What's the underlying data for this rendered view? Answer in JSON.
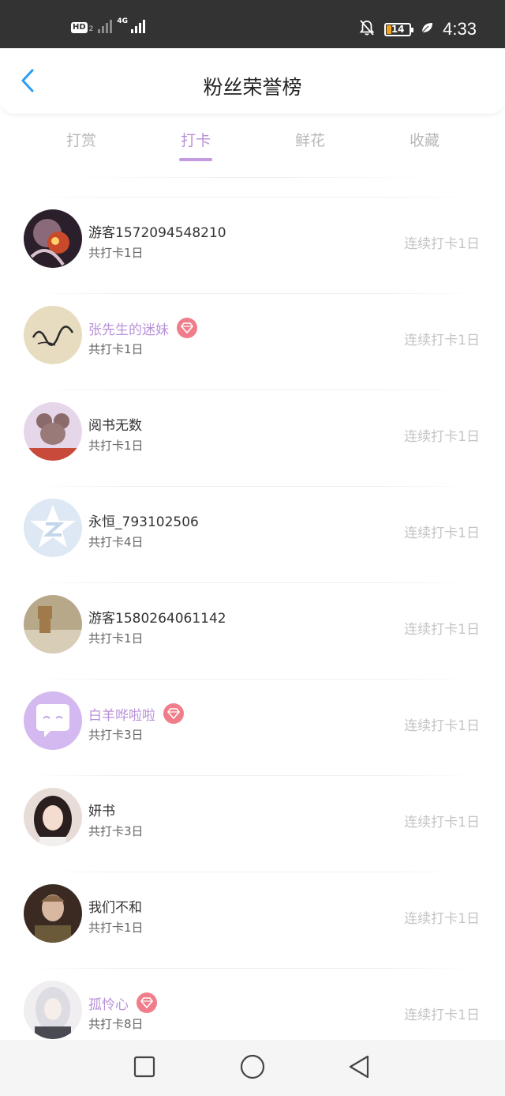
{
  "status_bar": {
    "hd_label": "HD",
    "hd_sub": "2",
    "network_label": "4G",
    "battery_level": "14",
    "time": "4:33",
    "icons": [
      "hd-icon",
      "signal-icon",
      "mute-bell-icon",
      "battery-icon",
      "leaf-icon"
    ]
  },
  "header": {
    "title": "粉丝荣誉榜",
    "back_icon": "chevron-left-icon"
  },
  "tabs": [
    {
      "label": "打赏",
      "active": false
    },
    {
      "label": "打卡",
      "active": true
    },
    {
      "label": "鲜花",
      "active": false
    },
    {
      "label": "收藏",
      "active": false
    }
  ],
  "colors": {
    "accent": "#c39be0",
    "vip_name": "#b892d8",
    "vip_badge": "#f07e8a",
    "muted": "#c4c4c4"
  },
  "list": [
    {
      "name": "游客1572094548210",
      "total": "共打卡1日",
      "streak": "连续打卡1日",
      "vip": false
    },
    {
      "name": "张先生的迷妹",
      "total": "共打卡1日",
      "streak": "连续打卡1日",
      "vip": true
    },
    {
      "name": "阅书无数",
      "total": "共打卡1日",
      "streak": "连续打卡1日",
      "vip": false
    },
    {
      "name": "永恒_793102506",
      "total": "共打卡4日",
      "streak": "连续打卡1日",
      "vip": false
    },
    {
      "name": "游客1580264061142",
      "total": "共打卡1日",
      "streak": "连续打卡1日",
      "vip": false
    },
    {
      "name": "白羊哗啦啦",
      "total": "共打卡3日",
      "streak": "连续打卡1日",
      "vip": true
    },
    {
      "name": "妍书",
      "total": "共打卡3日",
      "streak": "连续打卡1日",
      "vip": false
    },
    {
      "name": "我们不和",
      "total": "共打卡1日",
      "streak": "连续打卡1日",
      "vip": false
    },
    {
      "name": "孤怜心",
      "total": "共打卡8日",
      "streak": "连续打卡1日",
      "vip": true
    }
  ],
  "nav_bar": {
    "icons": [
      "recent-apps-icon",
      "home-icon",
      "back-triangle-icon"
    ]
  }
}
